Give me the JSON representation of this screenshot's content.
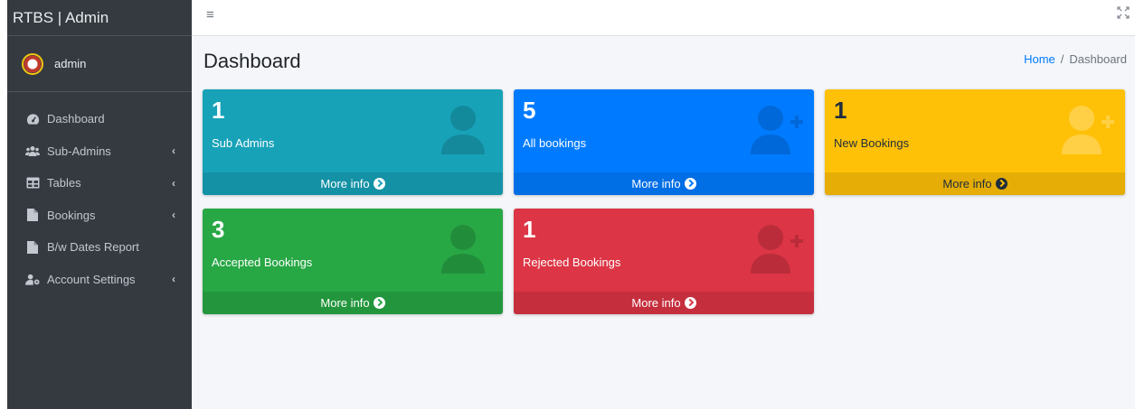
{
  "brand": {
    "title": "RTBS | Admin"
  },
  "user": {
    "name": "admin"
  },
  "sidebar": {
    "items": [
      {
        "label": "Dashboard",
        "icon": "tachometer-icon",
        "has_submenu": false
      },
      {
        "label": "Sub-Admins",
        "icon": "users-icon",
        "has_submenu": true
      },
      {
        "label": "Tables",
        "icon": "table-icon",
        "has_submenu": true
      },
      {
        "label": "Bookings",
        "icon": "file-icon",
        "has_submenu": true
      },
      {
        "label": "B/w Dates Report",
        "icon": "file-icon",
        "has_submenu": false
      },
      {
        "label": "Account Settings",
        "icon": "user-cog-icon",
        "has_submenu": true
      }
    ],
    "arrow": "‹"
  },
  "topbar": {
    "menu_glyph": "≡",
    "expand_glyph": "⛶"
  },
  "page": {
    "title": "Dashboard"
  },
  "breadcrumb": {
    "home": "Home",
    "separator": "/",
    "current": "Dashboard"
  },
  "boxes": [
    {
      "count": "1",
      "label": "Sub Admins",
      "footer": "More info",
      "color": "#17a2b8",
      "icon": "user-icon",
      "text": "light"
    },
    {
      "count": "5",
      "label": "All bookings",
      "footer": "More info",
      "color": "#007bff",
      "icon": "user-plus-icon",
      "text": "light"
    },
    {
      "count": "1",
      "label": "New Bookings",
      "footer": "More info",
      "color": "#ffc107",
      "icon": "user-plus-icon",
      "text": "dark"
    },
    {
      "count": "3",
      "label": "Accepted Bookings",
      "footer": "More info",
      "color": "#28a745",
      "icon": "user-icon",
      "text": "light"
    },
    {
      "count": "1",
      "label": "Rejected Bookings",
      "footer": "More info",
      "color": "#dc3545",
      "icon": "user-plus-icon",
      "text": "light"
    }
  ]
}
